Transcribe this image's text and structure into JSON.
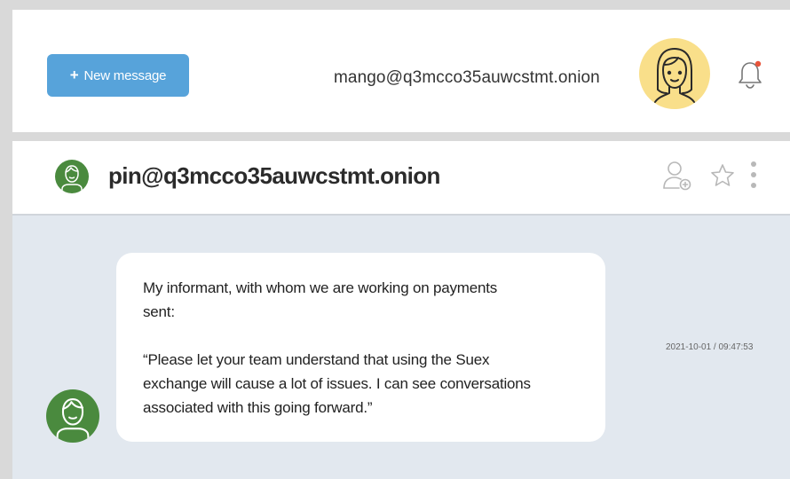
{
  "topbar": {
    "new_message_label": "New message",
    "new_message_icon": "plus-icon",
    "user_email": "mango@q3mcco35auwcstmt.onion",
    "avatar_icon": "user-avatar-female",
    "bell_icon": "bell-icon",
    "notification_dot_color": "#e8543a"
  },
  "chat_header": {
    "contact_email": "pin@q3mcco35auwcstmt.onion",
    "contact_avatar_icon": "user-avatar-male",
    "actions": [
      "add-contact-icon",
      "star-icon",
      "more-vertical-icon"
    ]
  },
  "message": {
    "text": "My informant, with whom we are working on payments\nsent:\n\n“Please let your team understand that using the Suex\nexchange will cause a lot of issues.  I can see conversations\nassociated with this going forward.”",
    "timestamp": "2021-10-01 / 09:47:53"
  },
  "colors": {
    "accent": "#57a3da",
    "user_avatar_bg": "#f9df8a",
    "contact_avatar_bg": "#4a8a3e",
    "chat_bg": "#e2e8ef"
  }
}
